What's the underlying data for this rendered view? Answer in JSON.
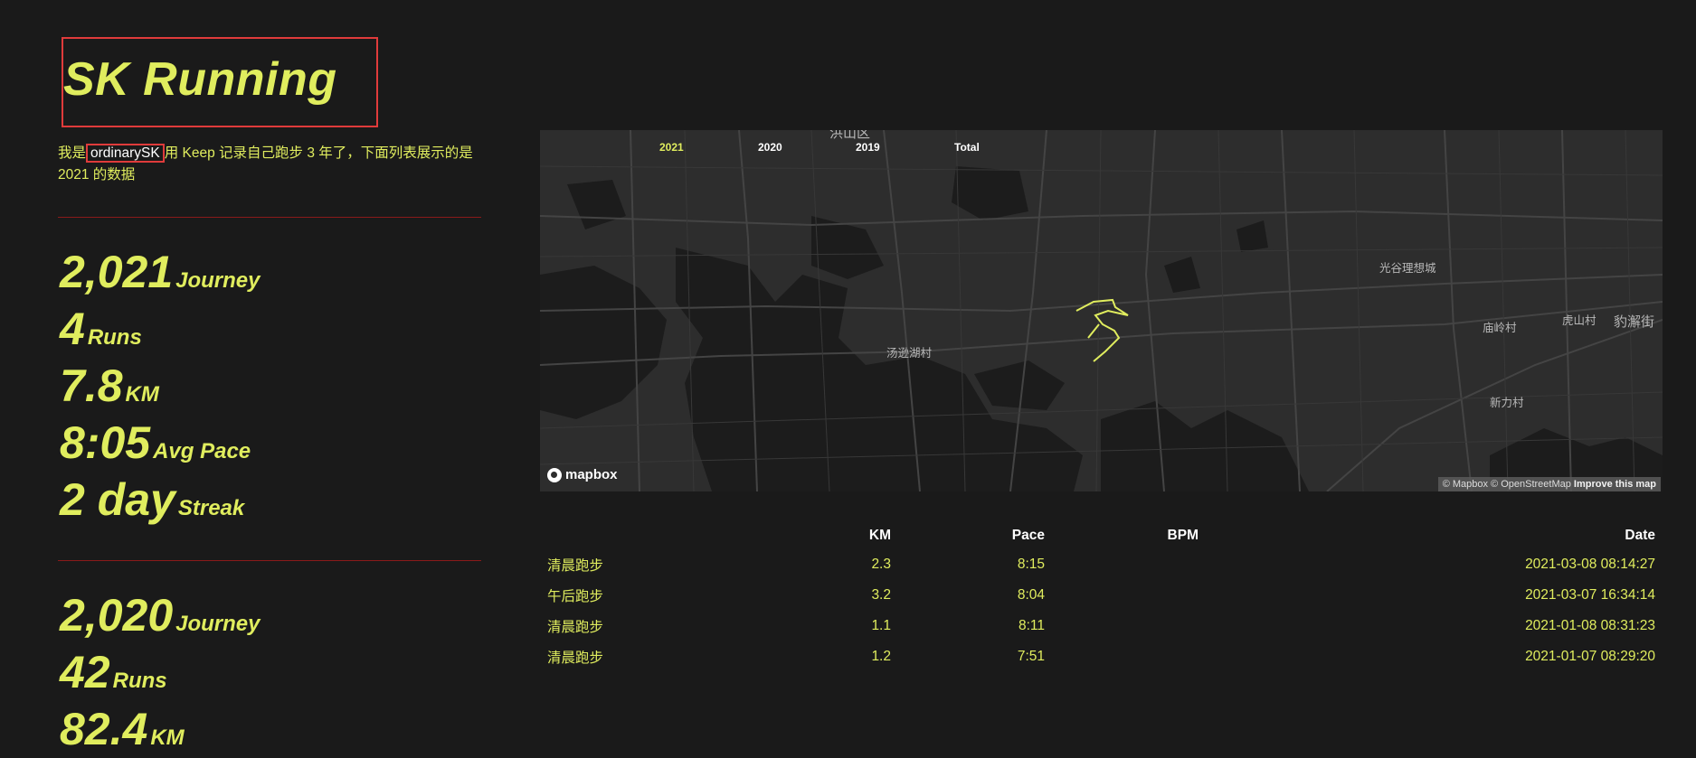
{
  "header": {
    "title": "SK Running",
    "intro_prefix": "我是",
    "intro_user": "ordinarySK",
    "intro_suffix": "用 Keep 记录自己跑步 3 年了，下面列表展示的是 2021 的数据"
  },
  "stats_2021": [
    {
      "value": "2,021",
      "unit": "Journey"
    },
    {
      "value": "4",
      "unit": "Runs"
    },
    {
      "value": "7.8",
      "unit": "KM"
    },
    {
      "value": "8:05",
      "unit": "Avg Pace"
    },
    {
      "value": "2 day",
      "unit": "Streak"
    }
  ],
  "stats_2020": [
    {
      "value": "2,020",
      "unit": "Journey"
    },
    {
      "value": "42",
      "unit": "Runs"
    },
    {
      "value": "82.4",
      "unit": "KM"
    }
  ],
  "map": {
    "year_tabs": [
      "2021",
      "2020",
      "2019",
      "Total"
    ],
    "active_year": "2021",
    "labels": {
      "top_district": "洪山区",
      "guanggu": "光谷理想城",
      "tangxun": "汤逊湖村",
      "miaoling": "庙岭村",
      "hushan": "虎山村",
      "baoxie": "豹澥街",
      "xinli": "新力村"
    },
    "logo_text": "mapbox",
    "attribution": "© Mapbox © OpenStreetMap",
    "improve_link": "Improve this map",
    "route_color": "#e0ed5e"
  },
  "runs_table": {
    "headers": {
      "name": "",
      "km": "KM",
      "pace": "Pace",
      "bpm": "BPM",
      "date": "Date"
    },
    "rows": [
      {
        "name": "清晨跑步",
        "km": "2.3",
        "pace": "8:15",
        "bpm": "",
        "date": "2021-03-08 08:14:27"
      },
      {
        "name": "午后跑步",
        "km": "3.2",
        "pace": "8:04",
        "bpm": "",
        "date": "2021-03-07 16:34:14"
      },
      {
        "name": "清晨跑步",
        "km": "1.1",
        "pace": "8:11",
        "bpm": "",
        "date": "2021-01-08 08:31:23"
      },
      {
        "name": "清晨跑步",
        "km": "1.2",
        "pace": "7:51",
        "bpm": "",
        "date": "2021-01-07 08:29:20"
      }
    ]
  },
  "colors": {
    "background": "#1a1a1a",
    "accent": "#e0ed5e",
    "divider": "#8b1a1a",
    "highlight_border": "#e03b3b"
  }
}
